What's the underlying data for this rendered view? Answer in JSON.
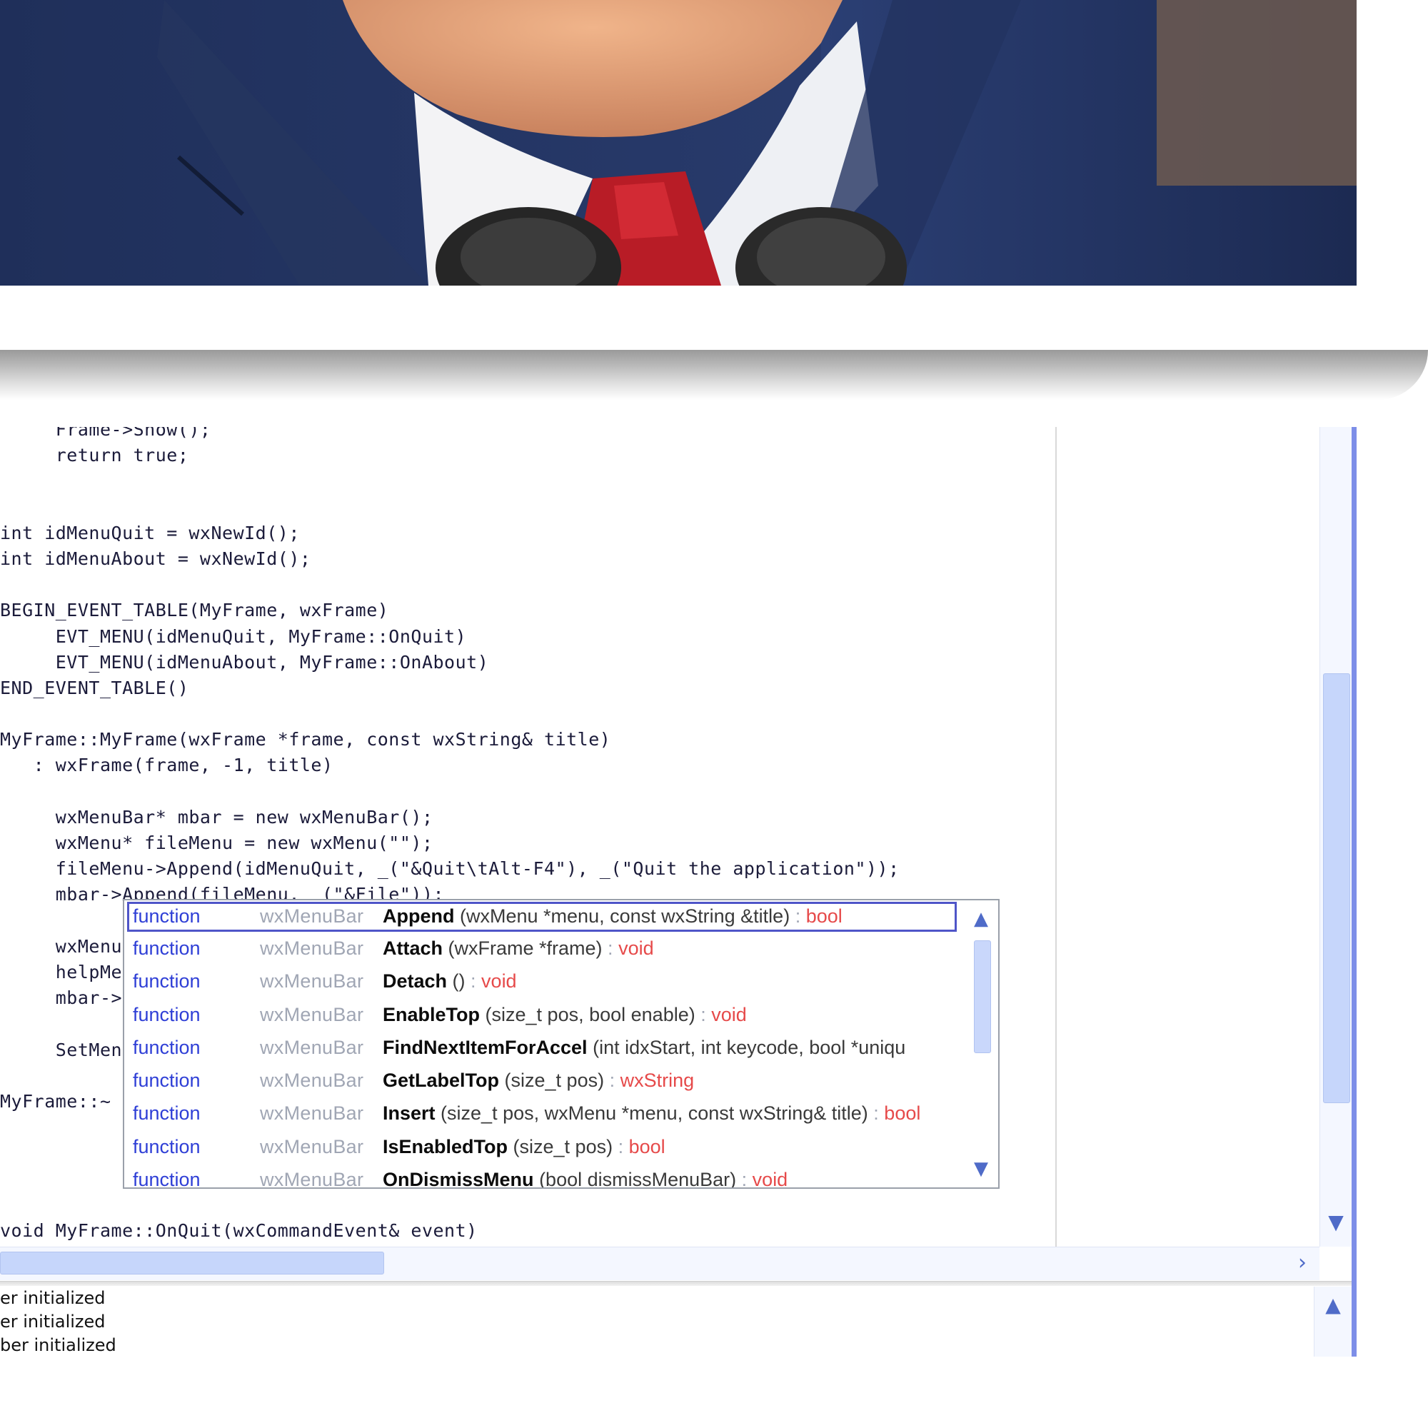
{
  "code_lines": [
    "     Frame->Show();",
    "     return true;",
    "",
    "",
    "int idMenuQuit = wxNewId();",
    "int idMenuAbout = wxNewId();",
    "",
    "BEGIN_EVENT_TABLE(MyFrame, wxFrame)",
    "     EVT_MENU(idMenuQuit, MyFrame::OnQuit)",
    "     EVT_MENU(idMenuAbout, MyFrame::OnAbout)",
    "END_EVENT_TABLE()",
    "",
    "MyFrame::MyFrame(wxFrame *frame, const wxString& title)",
    "   : wxFrame(frame, -1, title)",
    "",
    "     wxMenuBar* mbar = new wxMenuBar();",
    "     wxMenu* fileMenu = new wxMenu(\"\");",
    "     fileMenu->Append(idMenuQuit, _(\"&Quit\\tAlt-F4\"), _(\"Quit the application\"));",
    "     mbar->Append(fileMenu, _(\"&File\"));",
    "",
    "     wxMenu",
    "     helpMe                                                             pplication\"));",
    "     mbar->",
    "",
    "     SetMen",
    "",
    "MyFrame::~",
    "",
    "",
    "",
    "",
    "void MyFrame::OnQuit(wxCommandEvent& event)"
  ],
  "autocomplete": {
    "items": [
      {
        "kind": "function",
        "owner": "wxMenuBar",
        "name": "Append",
        "params": "(wxMenu *menu, const wxString &title)",
        "sep": " : ",
        "ret": "bool"
      },
      {
        "kind": "function",
        "owner": "wxMenuBar",
        "name": "Attach",
        "params": "(wxFrame *frame)",
        "sep": " : ",
        "ret": "void"
      },
      {
        "kind": "function",
        "owner": "wxMenuBar",
        "name": "Detach",
        "params": "()",
        "sep": " : ",
        "ret": "void"
      },
      {
        "kind": "function",
        "owner": "wxMenuBar",
        "name": "EnableTop",
        "params": "(size_t pos, bool enable)",
        "sep": " : ",
        "ret": "void"
      },
      {
        "kind": "function",
        "owner": "wxMenuBar",
        "name": "FindNextItemForAccel",
        "params": "(int idxStart, int keycode, bool *uniqu",
        "sep": "",
        "ret": ""
      },
      {
        "kind": "function",
        "owner": "wxMenuBar",
        "name": "GetLabelTop",
        "params": "(size_t pos)",
        "sep": " : ",
        "ret": "wxString"
      },
      {
        "kind": "function",
        "owner": "wxMenuBar",
        "name": "Insert",
        "params": "(size_t pos, wxMenu *menu, const wxString& title)",
        "sep": " : ",
        "ret": "bool"
      },
      {
        "kind": "function",
        "owner": "wxMenuBar",
        "name": "IsEnabledTop",
        "params": "(size_t pos)",
        "sep": " : ",
        "ret": "bool"
      },
      {
        "kind": "function",
        "owner": "wxMenuBar",
        "name": "OnDismissMenu",
        "params": "(bool dismissMenuBar)",
        "sep": " : ",
        "ret": "void"
      }
    ]
  },
  "log_lines": [
    "er initialized",
    "er initialized",
    "ber initialized"
  ],
  "icons": {
    "scroll_up": "▲",
    "scroll_down": "▼",
    "scroll_right": "›"
  }
}
